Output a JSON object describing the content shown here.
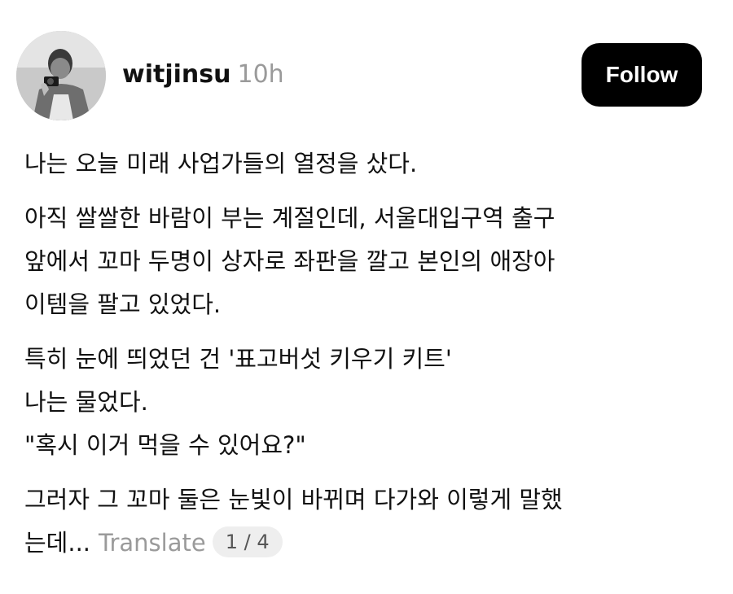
{
  "post": {
    "author": "witjinsu",
    "time": "10h",
    "follow_label": "Follow",
    "paragraphs": [
      [
        "나는 오늘 미래 사업가들의 열정을 샀다."
      ],
      [
        "아직 쌀쌀한 바람이 부는 계절인데, 서울대입구역 출구",
        "앞에서 꼬마 두명이 상자로 좌판을 깔고 본인의 애장아",
        "이템을 팔고 있었다."
      ],
      [
        "특히 눈에 띄었던 건 '표고버섯 키우기 키트'",
        "나는 물었다.",
        "\"혹시 이거 먹을 수 있어요?\""
      ],
      [
        "그러자 그 꼬마 둘은 눈빛이 바뀌며 다가와 이렇게 말했",
        "는데..."
      ]
    ],
    "translate_label": "Translate",
    "page_indicator": "1 / 4"
  },
  "icons": {
    "avatar": "profile-photo-person-with-camera"
  }
}
